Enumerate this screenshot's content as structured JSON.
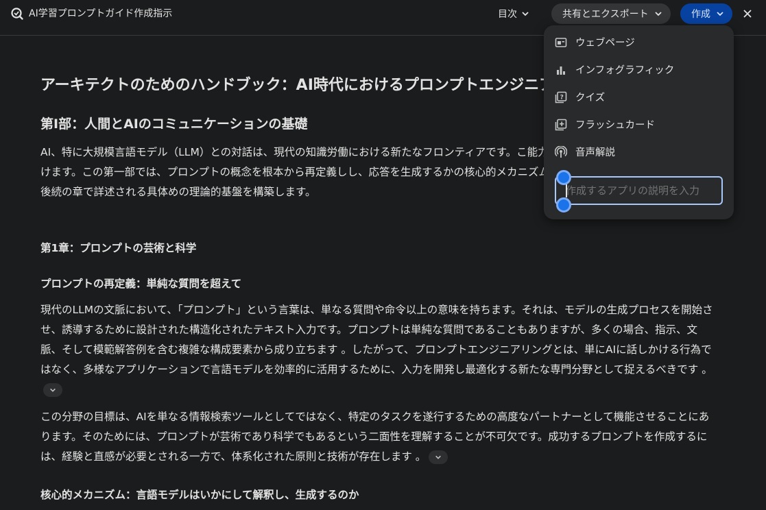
{
  "header": {
    "app_title": "AI学習プロンプトガイド作成指示",
    "toc_label": "目次",
    "share_label": "共有とエクスポート",
    "create_label": "作成"
  },
  "document": {
    "title": "アーキテクトのためのハンドブック：AI時代におけるプロンプトエンジニア",
    "part1_heading": "第I部：人間とAIのコミュニケーションの基礎",
    "part1_intro": "AI、特に大規模言語モデル（LLM）との対話は、現代の知識労働における新たなフロンティアです。こ能力をどれだけ引き出せるかを決定づけます。この第一部では、プロンプトの概念を根本から再定義しし、応答を生成するかの核心的メカニズムを解き明かします。これにより、後続の章で詳述される具体めの理論的基盤を構築します。",
    "chapter1_heading": "第1章：プロンプトの芸術と科学",
    "section1_heading": "プロンプトの再定義：単純な質問を超えて",
    "section1_para1": "現代のLLMの文脈において、「プロンプト」という言葉は、単なる質問や命令以上の意味を持ちます。それは、モデルの生成プロセスを開始させ、誘導するために設計された構造化されたテキスト入力です。プロンプトは単純な質問であることもありますが、多くの場合、指示、文脈、そして模範解答例を含む複雑な構成要素から成り立ちます 。したがって、プロンプトエンジニアリングとは、単にAIに話しかける行為ではなく、多様なアプリケーションで言語モデルを効率的に活用するために、入力を開発し最適化する新たな専門分野として捉えるべきです 。",
    "section1_para2": "この分野の目標は、AIを単なる情報検索ツールとしてではなく、特定のタスクを遂行するための高度なパートナーとして機能させることにあります。そのためには、プロンプトが芸術であり科学でもあるという二面性を理解することが不可欠です。成功するプロンプトを作成するには、経験と直感が必要とされる一方で、体系化された原則と技術が存在します 。",
    "section2_heading": "核心的メカニズム：言語モデルはいかにして解釈し、生成するのか"
  },
  "create_menu": {
    "items": [
      {
        "label": "ウェブページ",
        "icon": "web-page-icon"
      },
      {
        "label": "インフォグラフィック",
        "icon": "bar-chart-icon"
      },
      {
        "label": "クイズ",
        "icon": "quiz-icon"
      },
      {
        "label": "フラッシュカード",
        "icon": "flashcard-icon"
      },
      {
        "label": "音声解説",
        "icon": "podcast-icon"
      }
    ],
    "app_input_placeholder": "作成するアプリの説明を入力"
  },
  "colors": {
    "background": "#1b1c1d",
    "menu_bg": "#282a2c",
    "create_button": "#0842a0",
    "accent": "#a8c7fa"
  }
}
